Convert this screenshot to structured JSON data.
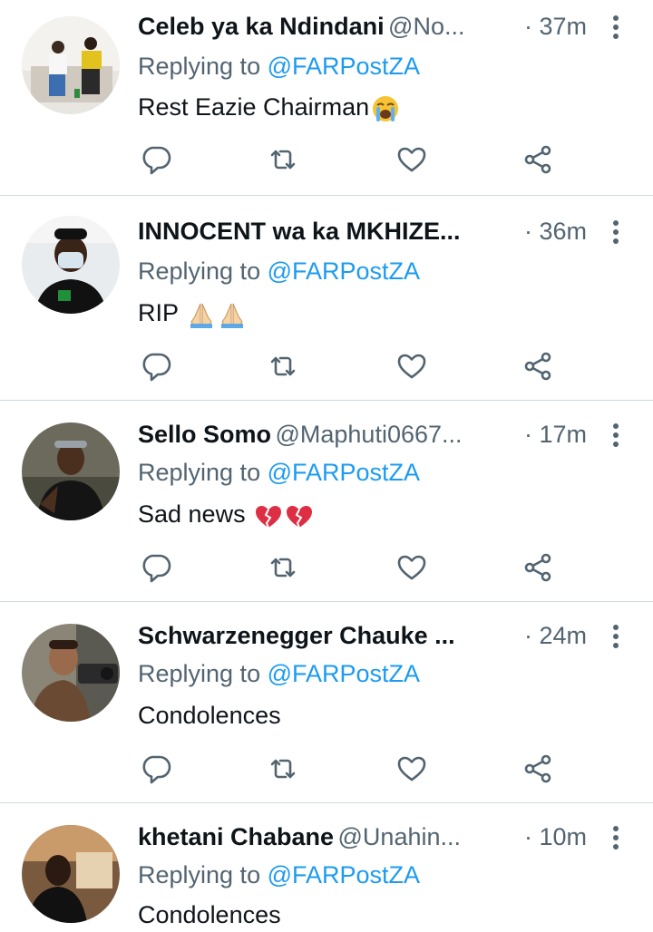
{
  "colors": {
    "text": "#0f1419",
    "secondary": "#536471",
    "accent": "#1d9bf0",
    "divider": "#cfd9de"
  },
  "replies": [
    {
      "name": "Celeb ya ka Ndindani",
      "handle": "@No...",
      "time": "· 37m",
      "replying_prefix": "Replying to ",
      "replying_to": "@FARPostZA",
      "text": "Rest Eazie Chairman",
      "emojis": [
        "loudly-crying-face-icon"
      ]
    },
    {
      "name": "INNOCENT wa ka MKHIZE...",
      "handle": "",
      "time": "· 36m",
      "replying_prefix": "Replying to ",
      "replying_to": "@FARPostZA",
      "text": "RIP ",
      "emojis": [
        "folded-hands-icon",
        "folded-hands-icon"
      ]
    },
    {
      "name": "Sello Somo",
      "handle": "@Maphuti0667...",
      "time": "· 17m",
      "replying_prefix": "Replying to ",
      "replying_to": "@FARPostZA",
      "text": "Sad news ",
      "emojis": [
        "broken-heart-icon",
        "broken-heart-icon"
      ]
    },
    {
      "name": "Schwarzenegger Chauke ...",
      "handle": "",
      "time": "· 24m",
      "replying_prefix": "Replying to ",
      "replying_to": "@FARPostZA",
      "text": "Condolences",
      "emojis": []
    },
    {
      "name": "khetani Chabane",
      "handle": "@Unahin...",
      "time": "· 10m",
      "replying_prefix": "Replying to ",
      "replying_to": "@FARPostZA",
      "text": "Condolences",
      "emojis": []
    }
  ]
}
